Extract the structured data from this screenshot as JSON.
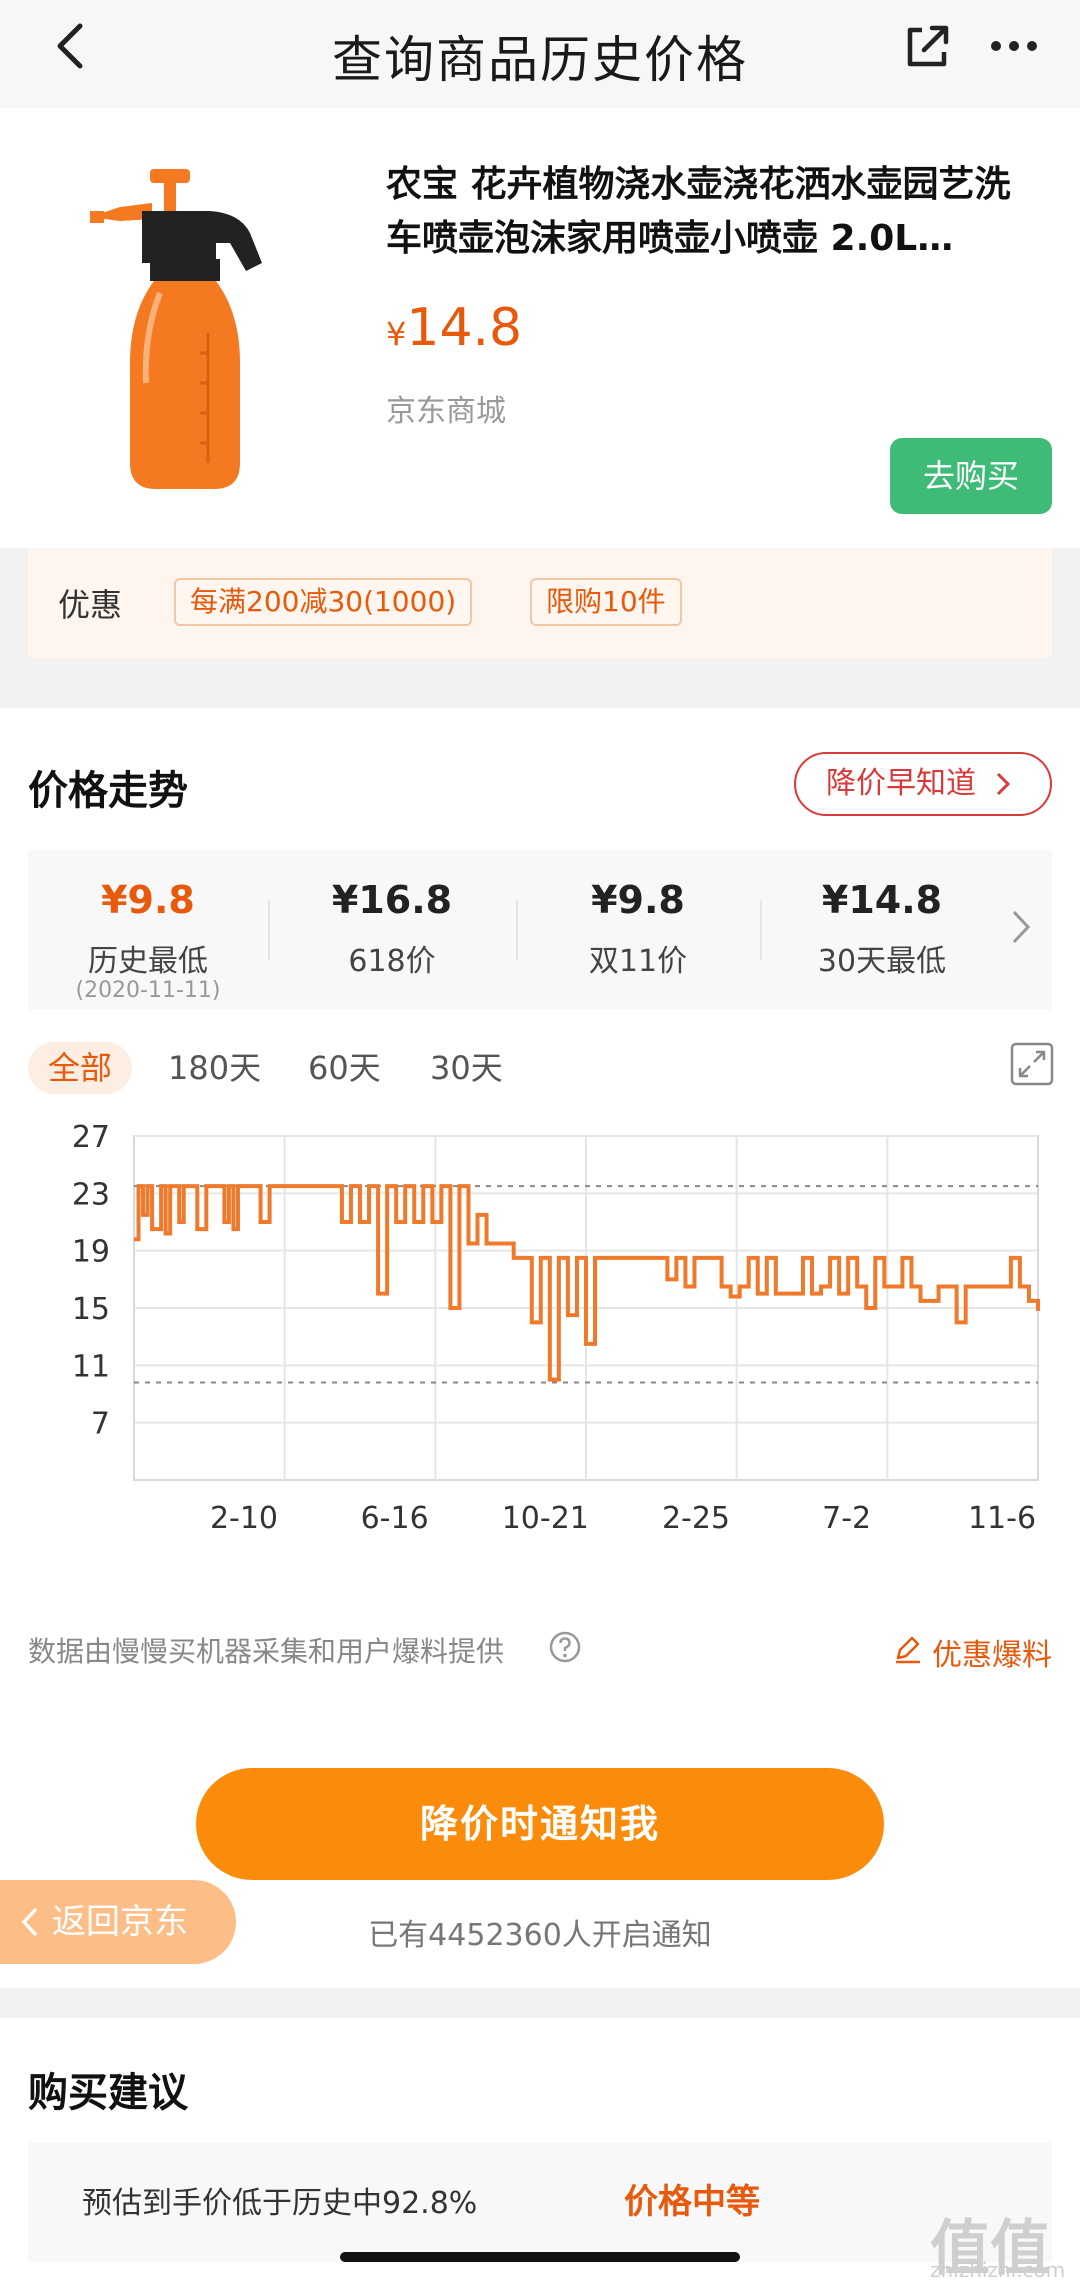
{
  "nav": {
    "title": "查询商品历史价格"
  },
  "product": {
    "title": "农宝 花卉植物浇水壶浇花洒水壶园艺洗车喷壶泡沫家用喷壶小喷壶 2.0L…",
    "currency": "¥",
    "price": "14.8",
    "shop": "京东商城",
    "buy_label": "去购买"
  },
  "promo": {
    "label": "优惠",
    "tags": [
      "每满200减30(1000)",
      "限购10件"
    ]
  },
  "trend": {
    "title": "价格走势",
    "notify_pill": "降价早知道",
    "stats": [
      {
        "price": "¥9.8",
        "label": "历史最低",
        "date": "(2020-11-11)"
      },
      {
        "price": "¥16.8",
        "label": "618价"
      },
      {
        "price": "¥9.8",
        "label": "双11价"
      },
      {
        "price": "¥14.8",
        "label": "30天最低"
      }
    ],
    "ranges": [
      "全部",
      "180天",
      "60天",
      "30天"
    ],
    "active_range": "全部",
    "data_note": "数据由慢慢买机器采集和用户爆料提供",
    "tipoff": "优惠爆料"
  },
  "chart_data": {
    "type": "line",
    "title": "",
    "xlabel": "",
    "ylabel": "",
    "y_ticks": [
      27,
      23,
      19,
      15,
      11,
      7
    ],
    "ylim": [
      3,
      27
    ],
    "x_tick_labels": [
      "2-10",
      "6-16",
      "10-21",
      "2-25",
      "7-2",
      "11-6"
    ],
    "reference_lines": [
      23.5,
      9.8
    ],
    "grid": true,
    "series": [
      {
        "color": "#f07a2b",
        "x": [
          0,
          0.5,
          1,
          1.5,
          2,
          3,
          3.5,
          4,
          5,
          5.5,
          6,
          7,
          8,
          9,
          10,
          10.5,
          11,
          11.5,
          12,
          13,
          14,
          15,
          16,
          16.5,
          17,
          18,
          19,
          20,
          21,
          22,
          23,
          24,
          25,
          26,
          27,
          28,
          29,
          30,
          31,
          32,
          33,
          34,
          35,
          36,
          37,
          38,
          39,
          40,
          41,
          42,
          43,
          44,
          45,
          46,
          47,
          48,
          49,
          50,
          51,
          52,
          53,
          54,
          55,
          56,
          57,
          58,
          59,
          60,
          61,
          62,
          63,
          64,
          65,
          66,
          67,
          68,
          69,
          70,
          71,
          72,
          73,
          74,
          75,
          76,
          77,
          78,
          79,
          80,
          81,
          82,
          83,
          84,
          85,
          86,
          87,
          88,
          89,
          90,
          91,
          92,
          93,
          94,
          95,
          96,
          97,
          98,
          99,
          100
        ],
        "values": [
          19.8,
          23.5,
          21.5,
          23.5,
          20.5,
          23.5,
          20.2,
          23.5,
          21.0,
          23.5,
          23.5,
          20.5,
          23.5,
          23.5,
          21.0,
          23.5,
          20.5,
          23.5,
          23.5,
          23.5,
          21.0,
          23.5,
          23.5,
          23.5,
          23.5,
          23.5,
          23.5,
          23.5,
          23.5,
          23.5,
          21.0,
          23.5,
          21.0,
          23.5,
          16.0,
          23.5,
          21.0,
          23.5,
          21.0,
          23.5,
          21.0,
          23.5,
          15.0,
          23.5,
          19.5,
          21.5,
          19.5,
          19.5,
          19.5,
          18.5,
          18.5,
          14.0,
          18.5,
          10.0,
          18.5,
          14.5,
          18.5,
          12.5,
          18.5,
          18.5,
          18.5,
          18.5,
          18.5,
          18.5,
          18.5,
          18.5,
          17.0,
          18.5,
          16.5,
          18.5,
          18.5,
          18.5,
          16.5,
          15.8,
          16.5,
          18.5,
          16.0,
          18.5,
          16.0,
          16.0,
          16.0,
          18.5,
          16.0,
          16.5,
          18.5,
          16.0,
          18.5,
          16.5,
          15.0,
          18.5,
          16.5,
          16.5,
          18.5,
          16.5,
          15.5,
          15.5,
          16.5,
          16.5,
          14.0,
          16.5,
          16.5,
          16.5,
          16.5,
          16.5,
          18.5,
          16.5,
          15.5,
          14.8
        ]
      }
    ]
  },
  "cta": {
    "button": "降价时通知我",
    "count_text": "已有4452360人开启通知",
    "back_label": "返回京东"
  },
  "advice": {
    "title": "购买建议",
    "text": "预估到手价低于历史中92.8%",
    "level": "价格中等"
  },
  "watermark": {
    "main": "值值值",
    "sub": "zhizhizhi.com"
  },
  "colors": {
    "accent": "#e8590c",
    "buy": "#3dbb77",
    "cta": "#fb8c0b",
    "line": "#f07a2b"
  }
}
